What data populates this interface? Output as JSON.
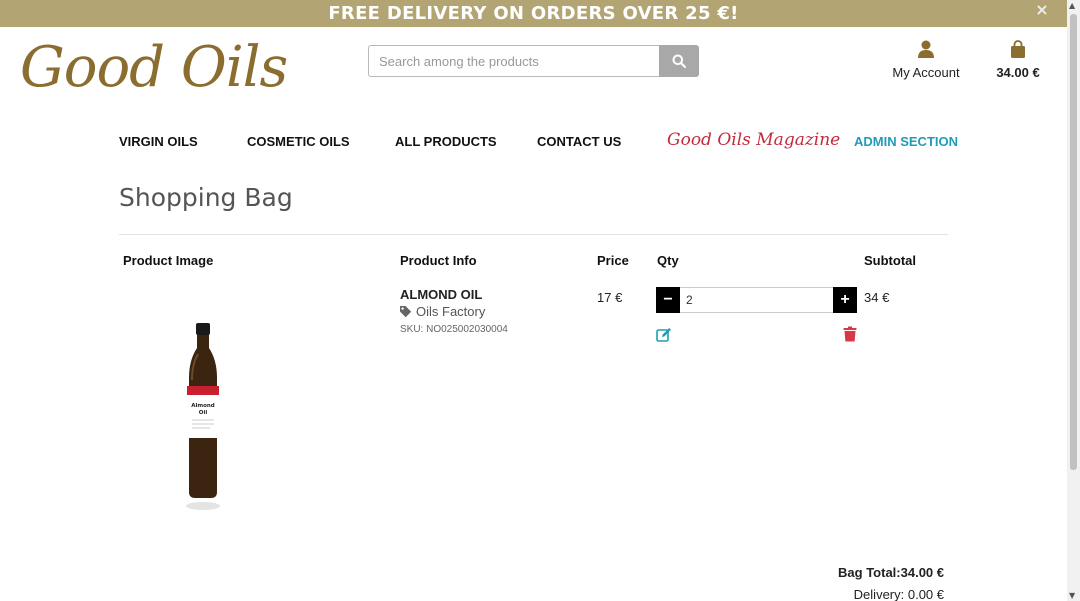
{
  "banner": {
    "text": "FREE DELIVERY ON ORDERS OVER 25 €!",
    "close_icon": "×",
    "color": "#b3a573"
  },
  "header": {
    "logo_text": "Good Oils",
    "search": {
      "placeholder": "Search among the products",
      "value": ""
    },
    "account_label": "My Account",
    "bag_total": "34.00 €"
  },
  "nav": {
    "virgin": "VIRGIN OILS",
    "cosmetic": "COSMETIC OILS",
    "all": "ALL PRODUCTS",
    "contact": "CONTACT US",
    "magazine": "Good Oils Magazine",
    "admin": "ADMIN SECTION"
  },
  "page": {
    "title": "Shopping Bag"
  },
  "table": {
    "headers": {
      "image": "Product Image",
      "info": "Product Info",
      "price": "Price",
      "qty": "Qty",
      "subtotal": "Subtotal"
    },
    "item": {
      "name": "ALMOND OIL",
      "brand": "Oils Factory",
      "sku": "SKU: NO025002030004",
      "price": "17 €",
      "qty": "2",
      "subtotal": "34 €",
      "label_line1": "Almond",
      "label_line2": "Oil"
    }
  },
  "totals": {
    "bag_total": "Bag Total:34.00 €",
    "delivery": "Delivery: 0.00 €"
  },
  "colors": {
    "brand": "#8a6d2f",
    "magazine": "#c52a3c",
    "admin": "#1e9db5",
    "edit": "#1e9db5",
    "remove": "#dc3545"
  }
}
